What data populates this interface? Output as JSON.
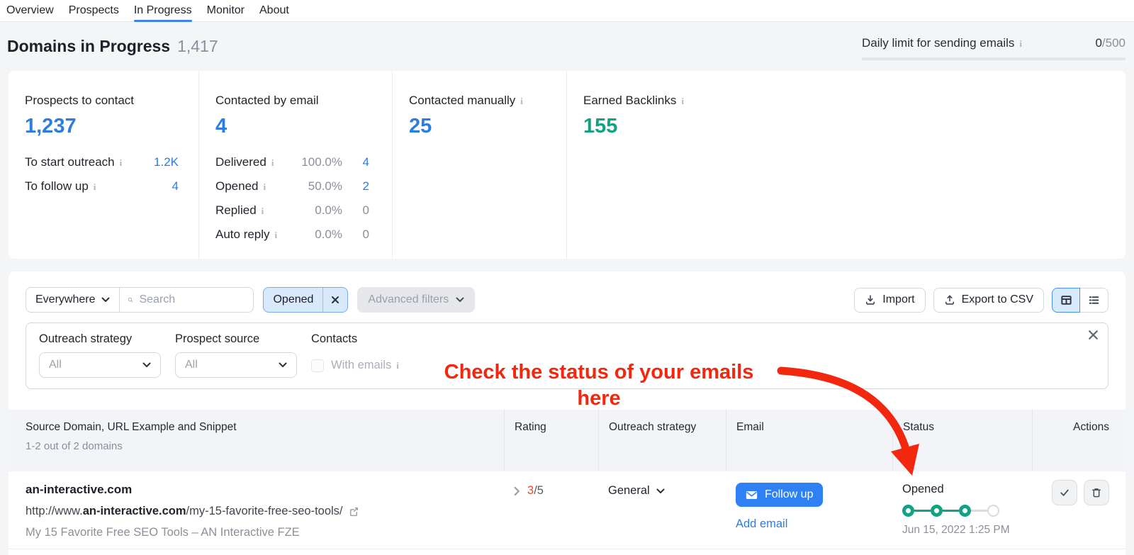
{
  "nav": {
    "items": [
      {
        "label": "Overview"
      },
      {
        "label": "Prospects"
      },
      {
        "label": "In Progress"
      },
      {
        "label": "Monitor"
      },
      {
        "label": "About"
      }
    ],
    "active": "In Progress"
  },
  "header": {
    "title": "Domains in Progress",
    "count": "1,417",
    "daily_limit": {
      "label": "Daily limit for sending emails",
      "used": "0",
      "total": "/500"
    }
  },
  "stats": {
    "prospects_to_contact": {
      "label": "Prospects to contact",
      "value": "1,237",
      "rows": [
        {
          "label": "To start outreach",
          "value": "1.2K"
        },
        {
          "label": "To follow up",
          "value": "4"
        }
      ]
    },
    "contacted_by_email": {
      "label": "Contacted by email",
      "value": "4",
      "rows": [
        {
          "label": "Delivered",
          "percent": "100.0%",
          "count": "4"
        },
        {
          "label": "Opened",
          "percent": "50.0%",
          "count": "2"
        },
        {
          "label": "Replied",
          "percent": "0.0%",
          "count": "0"
        },
        {
          "label": "Auto reply",
          "percent": "0.0%",
          "count": "0"
        }
      ]
    },
    "contacted_manually": {
      "label": "Contacted manually",
      "value": "25"
    },
    "earned_backlinks": {
      "label": "Earned Backlinks",
      "value": "155"
    }
  },
  "toolbar": {
    "scope_value": "Everywhere",
    "search_placeholder": "Search",
    "filter_chip": "Opened",
    "advanced_filters_label": "Advanced filters",
    "import_label": "Import",
    "export_label": "Export to CSV"
  },
  "filter_panel": {
    "outreach_strategy": {
      "label": "Outreach strategy",
      "value": "All"
    },
    "prospect_source": {
      "label": "Prospect source",
      "value": "All"
    },
    "contacts": {
      "label": "Contacts",
      "checkbox_label": "With emails",
      "checked": false
    }
  },
  "annotation": {
    "line1": "Check the status of your emails",
    "line2": "here"
  },
  "table": {
    "headers": {
      "source": "Source Domain, URL Example and Snippet",
      "source_sub": "1-2 out of 2 domains",
      "rating": "Rating",
      "outreach": "Outreach strategy",
      "email": "Email",
      "status": "Status",
      "actions": "Actions"
    },
    "rows": [
      {
        "domain": "an-interactive.com",
        "url_prefix": "http://www.",
        "url_domain": "an-interactive.com",
        "url_path": "/my-15-favorite-free-seo-tools/",
        "snippet": "My 15 Favorite Free SEO Tools – AN Interactive FZE",
        "rating_value": "3",
        "rating_total": "/5",
        "outreach_strategy": "General",
        "email_button": "Follow up",
        "email_link": "Add email",
        "status": "Opened",
        "status_date": "Jun 15, 2022 1:25 PM",
        "status_steps_done": 3,
        "status_steps_total": 4
      }
    ]
  },
  "icons": {
    "info_glyph": "i"
  },
  "colors": {
    "accent_blue": "#2b7de2",
    "button_blue": "#2e81f5",
    "green": "#12a182",
    "annotation_red": "#f3260e",
    "rating_orange": "#e8472a",
    "chip_blue_bg": "#d9e9fc"
  }
}
